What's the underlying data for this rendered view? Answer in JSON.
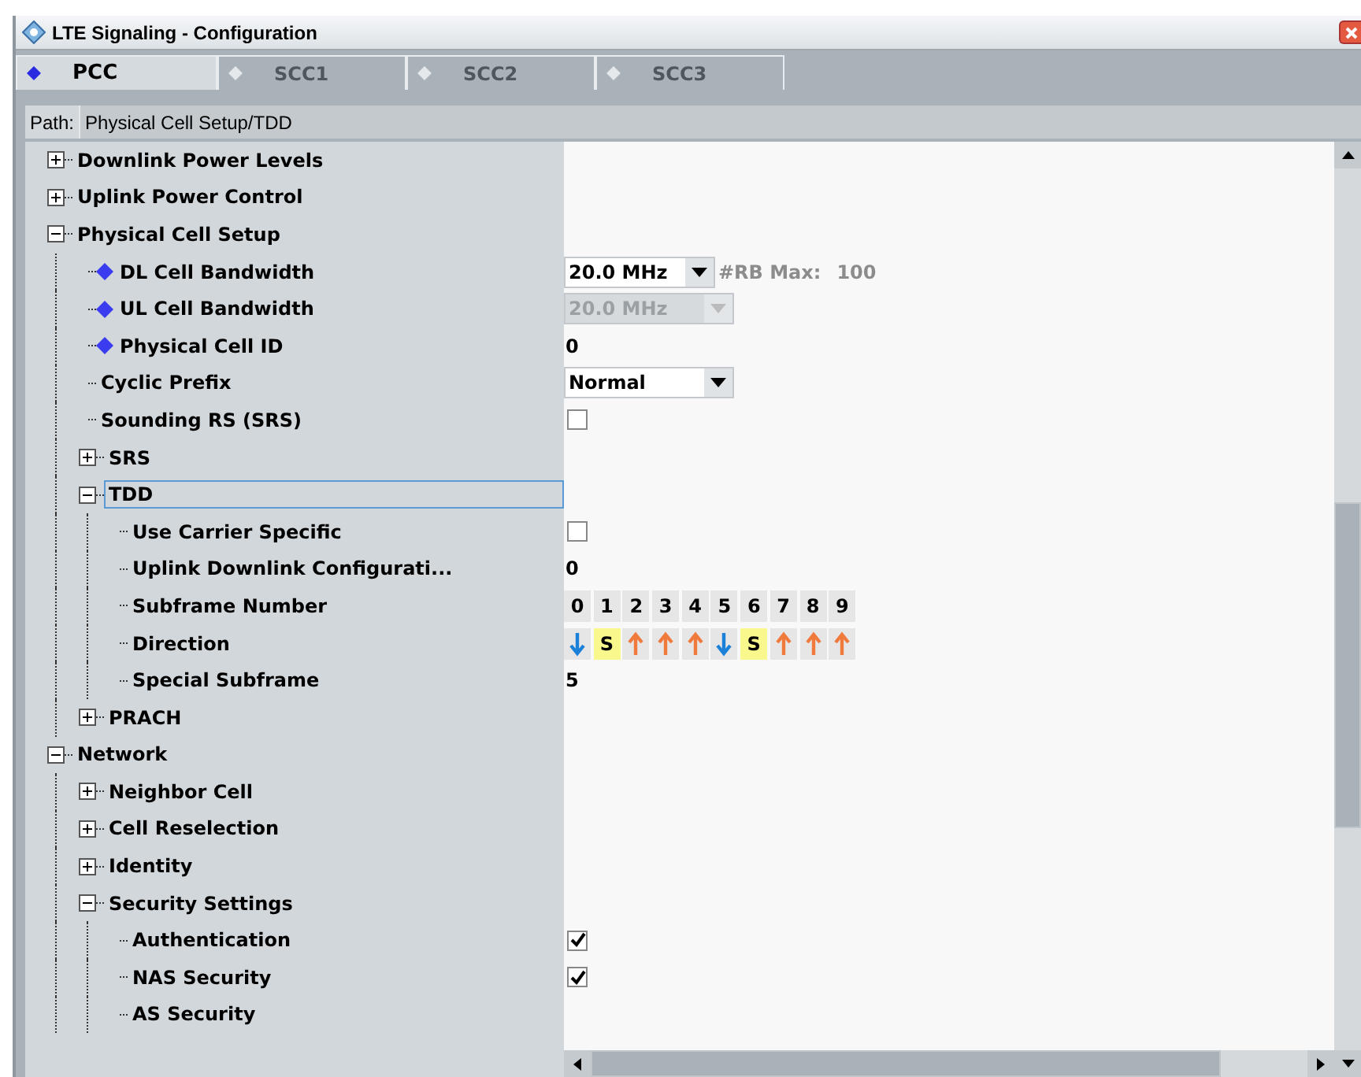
{
  "window": {
    "title": "LTE Signaling  - Configuration"
  },
  "tabs": [
    {
      "label": "PCC",
      "selected": true
    },
    {
      "label": "SCC1",
      "selected": false
    },
    {
      "label": "SCC2",
      "selected": false
    },
    {
      "label": "SCC3",
      "selected": false
    }
  ],
  "path": {
    "label": "Path:",
    "value": "Physical Cell Setup/TDD"
  },
  "tree": [
    {
      "label": "Downlink Power Levels",
      "expanded": false,
      "selected": false
    },
    {
      "label": "Uplink Power Control",
      "expanded": false,
      "selected": false
    },
    {
      "label": "Physical Cell Setup",
      "expanded": true,
      "selected": false,
      "children": [
        {
          "label": "DL Cell Bandwidth",
          "diamond": true,
          "selected": false,
          "value": {
            "kind": "dropdown",
            "text": "20.0 MHz",
            "disabled": false,
            "note_label": "#RB Max:",
            "note_value": "100"
          }
        },
        {
          "label": "UL Cell Bandwidth",
          "diamond": true,
          "selected": false,
          "value": {
            "kind": "dropdown",
            "text": "20.0 MHz",
            "disabled": true
          }
        },
        {
          "label": "Physical Cell ID",
          "diamond": true,
          "selected": false,
          "value": {
            "kind": "text",
            "text": "0"
          }
        },
        {
          "label": "Cyclic Prefix",
          "selected": false,
          "value": {
            "kind": "dropdown",
            "text": "Normal",
            "disabled": false
          }
        },
        {
          "label": "Sounding RS (SRS)",
          "selected": false,
          "value": {
            "kind": "checkbox",
            "checked": false
          }
        },
        {
          "label": "SRS",
          "expanded": false,
          "selected": false
        },
        {
          "label": "TDD",
          "expanded": true,
          "selected": true,
          "children": [
            {
              "label": "Use Carrier Specific",
              "selected": false,
              "value": {
                "kind": "checkbox",
                "checked": false
              }
            },
            {
              "label": "Uplink Downlink Configurati...",
              "selected": false,
              "value": {
                "kind": "text",
                "text": "0"
              }
            },
            {
              "label": "Subframe Number",
              "selected": false,
              "value": {
                "kind": "subframes",
                "items": [
                  "0",
                  "1",
                  "2",
                  "3",
                  "4",
                  "5",
                  "6",
                  "7",
                  "8",
                  "9"
                ]
              }
            },
            {
              "label": "Direction",
              "selected": false,
              "value": {
                "kind": "directions",
                "items": [
                  {
                    "kind": "down"
                  },
                  {
                    "kind": "special",
                    "text": "S"
                  },
                  {
                    "kind": "up"
                  },
                  {
                    "kind": "up"
                  },
                  {
                    "kind": "up"
                  },
                  {
                    "kind": "down"
                  },
                  {
                    "kind": "special",
                    "text": "S"
                  },
                  {
                    "kind": "up"
                  },
                  {
                    "kind": "up"
                  },
                  {
                    "kind": "up"
                  }
                ]
              }
            },
            {
              "label": "Special Subframe",
              "selected": false,
              "value": {
                "kind": "text",
                "text": "5"
              }
            }
          ]
        },
        {
          "label": "PRACH",
          "expanded": false,
          "selected": false
        }
      ]
    },
    {
      "label": "Network",
      "expanded": true,
      "selected": false,
      "children": [
        {
          "label": "Neighbor Cell",
          "expanded": false,
          "selected": false
        },
        {
          "label": "Cell Reselection",
          "expanded": false,
          "selected": false
        },
        {
          "label": "Identity",
          "expanded": false,
          "selected": false
        },
        {
          "label": "Security Settings",
          "expanded": true,
          "selected": false,
          "children": [
            {
              "label": "Authentication",
              "selected": false,
              "value": {
                "kind": "checkbox",
                "checked": true
              }
            },
            {
              "label": "NAS Security",
              "selected": false,
              "value": {
                "kind": "checkbox",
                "checked": true
              }
            },
            {
              "label": "AS Security",
              "selected": false
            }
          ]
        }
      ]
    }
  ]
}
